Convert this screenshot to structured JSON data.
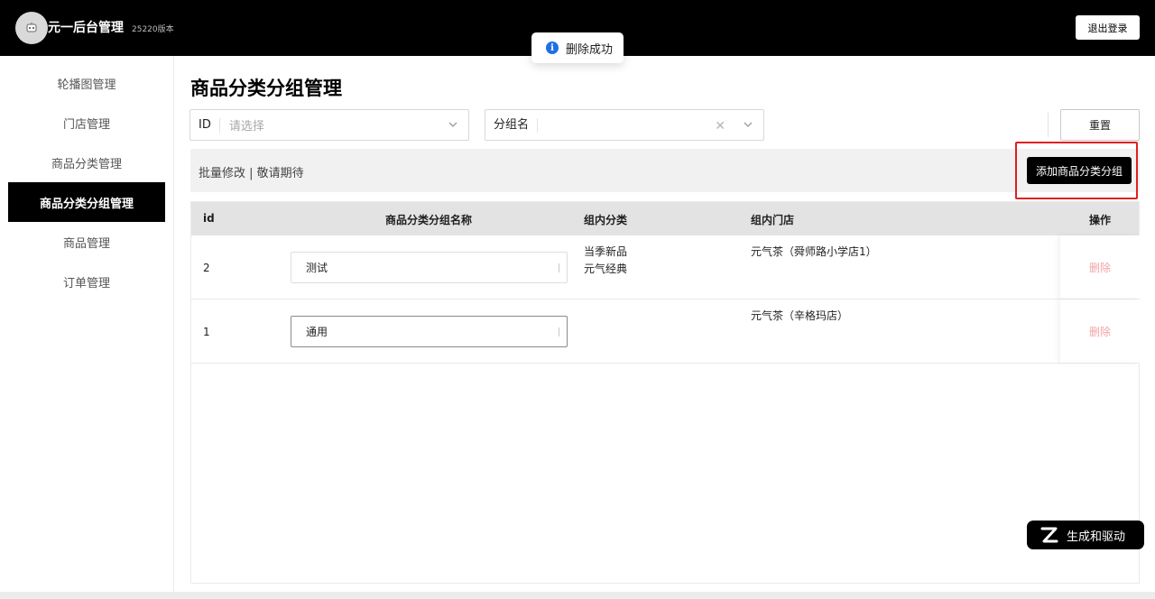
{
  "header": {
    "title": "元一后台管理",
    "version": "25220版本",
    "logout_label": "退出登录",
    "avatar_icon": "robot-avatar-icon"
  },
  "toast": {
    "icon": "info-icon",
    "icon_glyph": "i",
    "message": "删除成功"
  },
  "sidebar": {
    "items": [
      {
        "label": "轮播图管理"
      },
      {
        "label": "门店管理"
      },
      {
        "label": "商品分类管理"
      },
      {
        "label": "商品分类分组管理",
        "active": true
      },
      {
        "label": "商品管理"
      },
      {
        "label": "订单管理"
      }
    ]
  },
  "main": {
    "title": "商品分类分组管理",
    "filters": {
      "id": {
        "label": "ID",
        "placeholder": "请选择"
      },
      "group_name": {
        "label": "分组名",
        "value": ""
      }
    },
    "reset_label": "重置",
    "toolbar_text": "批量修改 | 敬请期待",
    "add_label": "添加商品分类分组"
  },
  "table": {
    "headers": [
      "id",
      "商品分类分组名称",
      "组内分类",
      "组内门店",
      "操作"
    ],
    "rows": [
      {
        "id": "2",
        "name": "测试",
        "categories": [
          "当季新品",
          "元气经典"
        ],
        "stores": [
          "元气茶（舜师路小学店1）"
        ],
        "action": "删除"
      },
      {
        "id": "1",
        "name": "通用",
        "categories": [],
        "stores": [
          "元气茶（辛格玛店）"
        ],
        "action": "删除"
      }
    ]
  },
  "badge": {
    "icon": "z-logo-icon",
    "label": "生成和驱动"
  },
  "colors": {
    "primary": "#000000",
    "highlight_border": "#e02020",
    "delete_link": "#f3a5a5",
    "toast_icon": "#1f6fe5"
  }
}
